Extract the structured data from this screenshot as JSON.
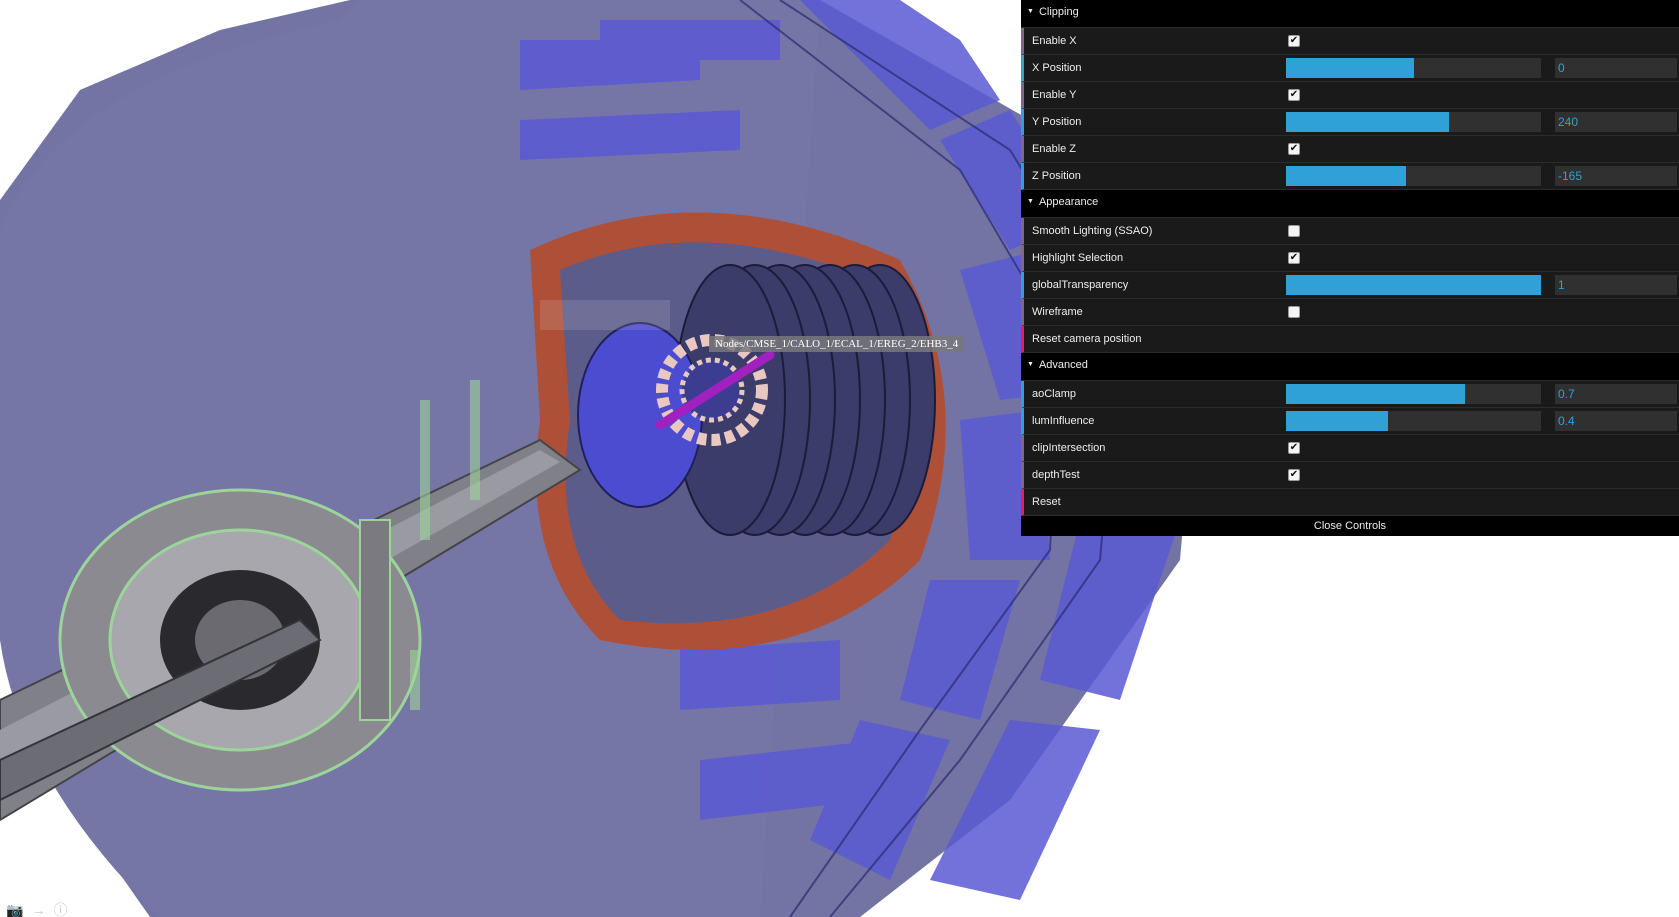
{
  "viewer": {
    "tooltip": "Nodes/CMSE_1/CALO_1/ECAL_1/EREG_2/EHB3_4",
    "icons": [
      "camera-icon",
      "arrow-right-icon",
      "help-icon"
    ],
    "colors": {
      "detector_body": "#6f6fa0",
      "detector_dark": "#4b4b7e",
      "muon_chambers": "#5a58d6",
      "calorimeter": "#c4421a",
      "beam_pipe": "#7a7a80",
      "endcap_green": "#9cd49a",
      "tracker_rings": "#e8c8c0",
      "beam_core": "#a020c0"
    }
  },
  "gui": {
    "colors": {
      "number": "#2fa1d6",
      "boolean": "#806787",
      "function": "#e61d5f",
      "background": "#1a1a1a"
    },
    "folders": [
      {
        "title": "Clipping",
        "rows": [
          {
            "label": "Enable X",
            "type": "bool",
            "checked": true
          },
          {
            "label": "X Position",
            "type": "number",
            "value": "0",
            "fill": 0.5
          },
          {
            "label": "Enable Y",
            "type": "bool",
            "checked": true
          },
          {
            "label": "Y Position",
            "type": "number",
            "value": "240",
            "fill": 0.64
          },
          {
            "label": "Enable Z",
            "type": "bool",
            "checked": true
          },
          {
            "label": "Z Position",
            "type": "number",
            "value": "-165",
            "fill": 0.47
          }
        ]
      },
      {
        "title": "Appearance",
        "rows": [
          {
            "label": "Smooth Lighting (SSAO)",
            "type": "bool",
            "checked": false
          },
          {
            "label": "Highlight Selection",
            "type": "bool",
            "checked": true
          },
          {
            "label": "globalTransparency",
            "type": "number",
            "value": "1",
            "fill": 1.0
          },
          {
            "label": "Wireframe",
            "type": "bool",
            "checked": false
          },
          {
            "label": "Reset camera position",
            "type": "function"
          }
        ]
      },
      {
        "title": "Advanced",
        "rows": [
          {
            "label": "aoClamp",
            "type": "number",
            "value": "0.7",
            "fill": 0.7
          },
          {
            "label": "lumInfluence",
            "type": "number",
            "value": "0.4",
            "fill": 0.4
          },
          {
            "label": "clipIntersection",
            "type": "bool",
            "checked": true
          },
          {
            "label": "depthTest",
            "type": "bool",
            "checked": true
          },
          {
            "label": "Reset",
            "type": "function"
          }
        ]
      }
    ],
    "close_label": "Close Controls"
  }
}
